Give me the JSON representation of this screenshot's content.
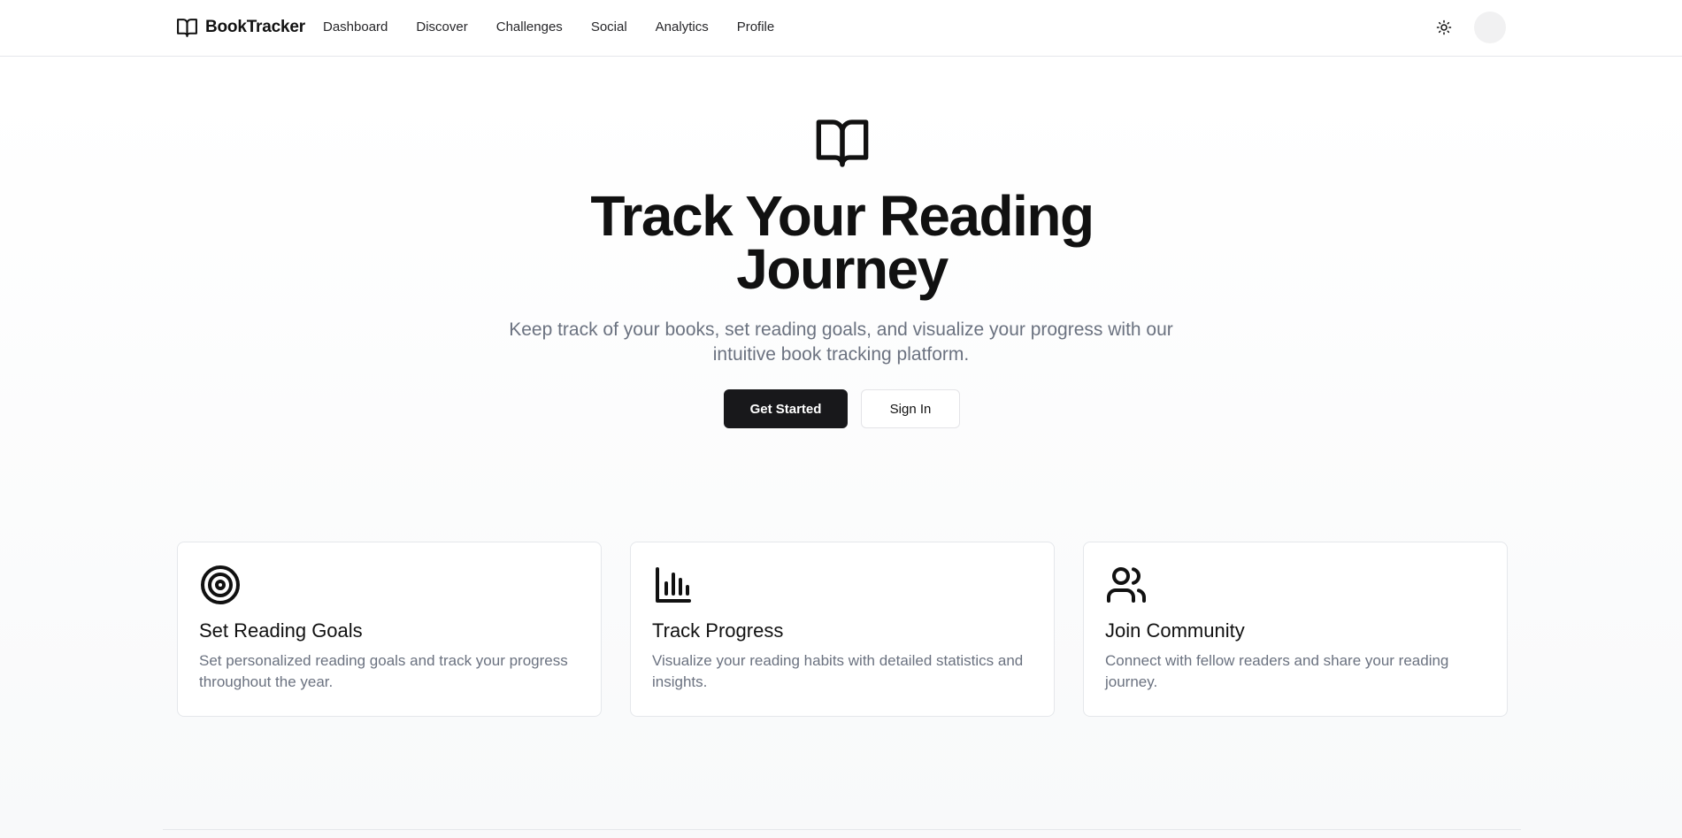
{
  "header": {
    "brand": "BookTracker",
    "nav": [
      "Dashboard",
      "Discover",
      "Challenges",
      "Social",
      "Analytics",
      "Profile"
    ],
    "theme_icon": "sun-icon",
    "avatar_icon": "avatar"
  },
  "hero": {
    "icon": "book-open-icon",
    "title": "Track Your Reading Journey",
    "subtitle": "Keep track of your books, set reading goals, and visualize your progress with our intuitive book tracking platform.",
    "primary_button": "Get Started",
    "secondary_button": "Sign In"
  },
  "features": [
    {
      "icon": "target-icon",
      "title": "Set Reading Goals",
      "description": "Set personalized reading goals and track your progress throughout the year."
    },
    {
      "icon": "bar-chart-icon",
      "title": "Track Progress",
      "description": "Visualize your reading habits with detailed statistics and insights."
    },
    {
      "icon": "users-icon",
      "title": "Join Community",
      "description": "Connect with fellow readers and share your reading journey."
    }
  ],
  "colors": {
    "primary": "#18181b",
    "muted_text": "#6b7280",
    "border": "#e5e7eb"
  }
}
